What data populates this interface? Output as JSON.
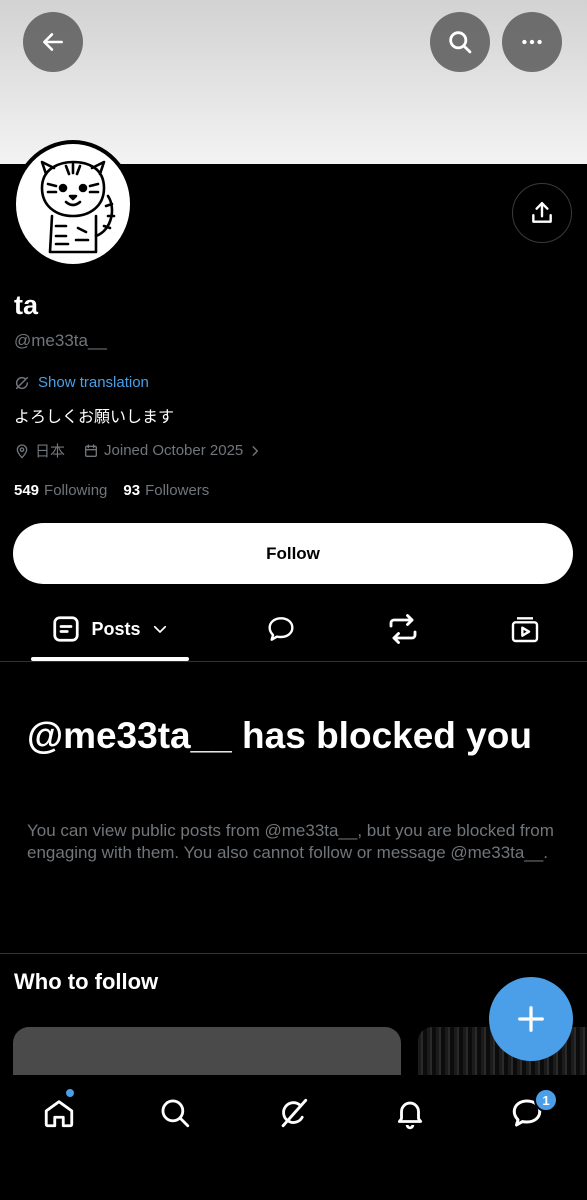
{
  "profile": {
    "name": "ta",
    "handle": "@me33ta__",
    "show_translation_label": "Show translation",
    "bio": "よろしくお願いします",
    "location": "日本",
    "joined": "Joined October 2025",
    "following_count": "549",
    "following_label": "Following",
    "followers_count": "93",
    "followers_label": "Followers",
    "follow_button_label": "Follow"
  },
  "tabs": {
    "posts_label": "Posts"
  },
  "blocked": {
    "title": "@me33ta__ has blocked you",
    "description": "You can view public posts from @me33ta__, but you are blocked from engaging with them. You also cannot follow or message @me33ta__."
  },
  "who_to_follow": {
    "title": "Who to follow"
  },
  "bottom_nav": {
    "messages_badge": "1"
  },
  "colors": {
    "accent": "#4a9fe8",
    "background": "#000000",
    "muted_text": "#71767b"
  },
  "icons": [
    "back-arrow-icon",
    "search-icon",
    "more-icon",
    "share-icon",
    "translate-icon",
    "location-icon",
    "calendar-icon",
    "chevron-right-icon",
    "posts-icon",
    "chevron-down-icon",
    "reply-icon",
    "repost-icon",
    "media-icon",
    "plus-icon",
    "home-icon",
    "grok-icon",
    "bell-icon",
    "messages-icon"
  ]
}
